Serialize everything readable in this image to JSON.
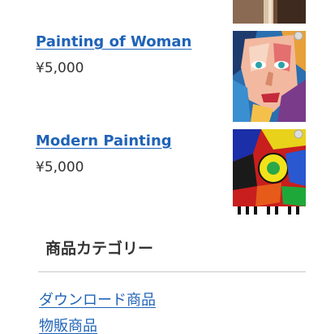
{
  "products": [
    {
      "title": "Painting of Woman",
      "price": "¥5,000"
    },
    {
      "title": "Modern Painting",
      "price": "¥5,000"
    }
  ],
  "category_widget": {
    "title": "商品カテゴリー",
    "links": [
      "ダウンロード商品",
      "物販商品"
    ]
  },
  "colors": {
    "link": "#1f63b8",
    "text": "#333333",
    "divider": "#c8c8c8"
  }
}
